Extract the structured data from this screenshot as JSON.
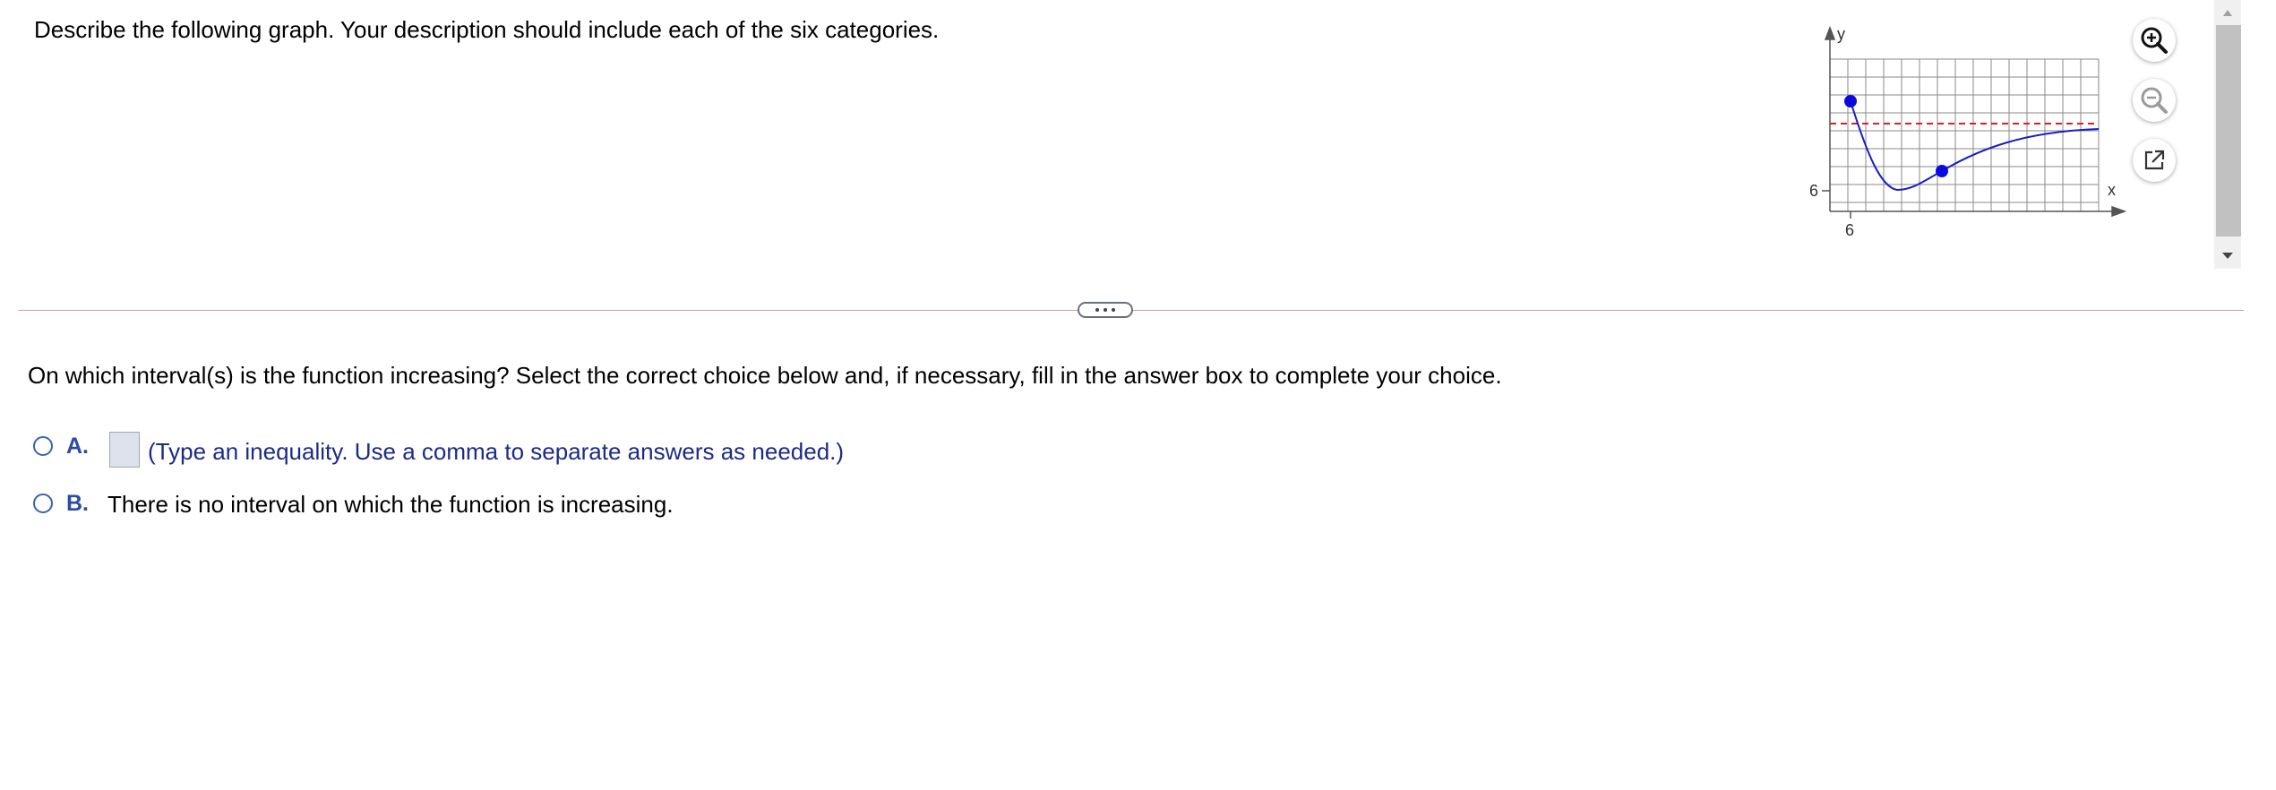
{
  "question": {
    "prompt": "Describe the following graph. Your description should include each of the six categories."
  },
  "graph": {
    "x_label": "x",
    "y_label": "y",
    "x_tick_label": "6",
    "y_tick_label": "6",
    "curve_color": "#1a1fc1",
    "asymptote_color": "#e02020",
    "point_color": "#0a0ae0"
  },
  "tools": {
    "zoom_in_icon": "zoom-in-icon",
    "zoom_out_icon": "zoom-out-icon",
    "popout_icon": "external-link-icon"
  },
  "sub_question": {
    "text": "On which interval(s) is the function increasing? Select the correct choice below and, if necessary, fill in the answer box to complete your choice."
  },
  "choices": [
    {
      "label": "A.",
      "answer_value": "",
      "hint": "(Type an inequality. Use a comma to separate answers as needed.)"
    },
    {
      "label": "B.",
      "text": "There is no interval on which the function is increasing."
    }
  ],
  "colors": {
    "accent": "#2d4ba3",
    "hint_text": "#1c2b86",
    "divider": "#c49ca3"
  }
}
